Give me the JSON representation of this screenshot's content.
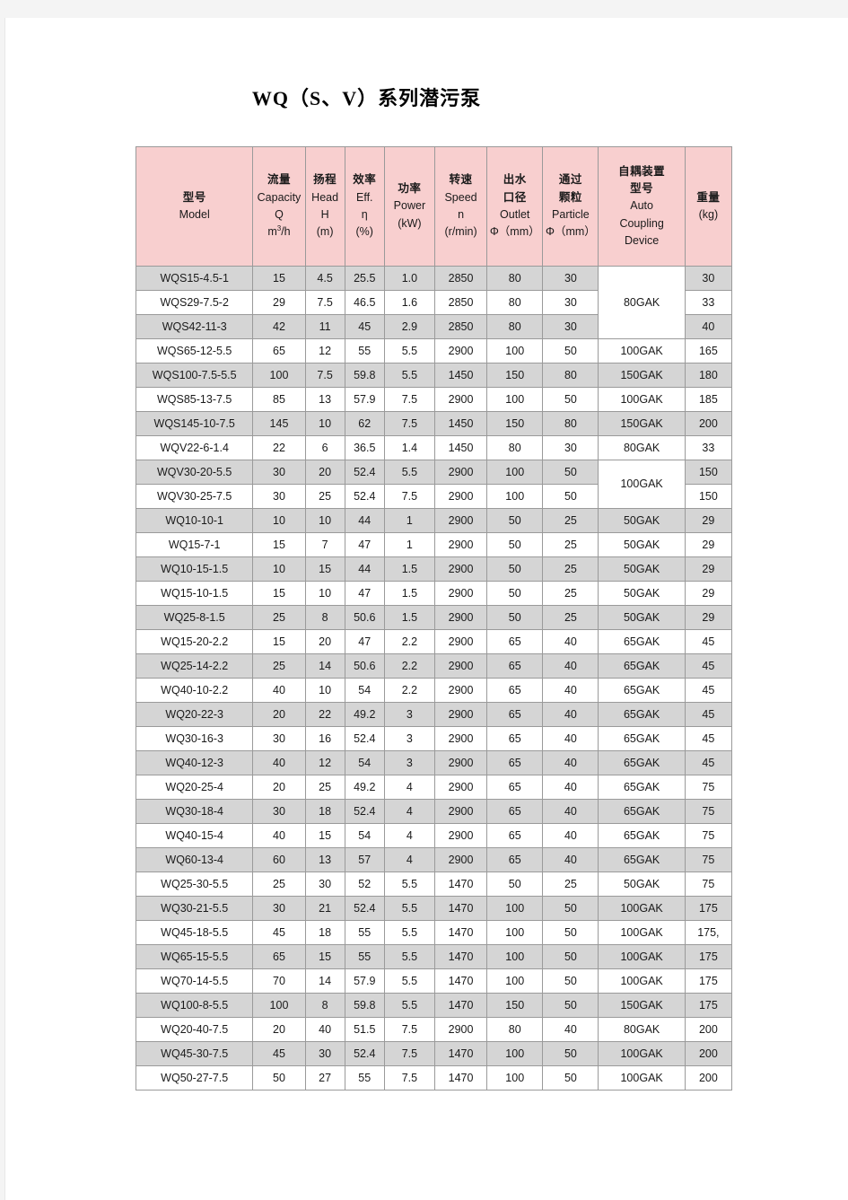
{
  "document": {
    "title": "WQ（S、V）系列潜污泵"
  },
  "table": {
    "columns": [
      {
        "key": "model",
        "cn": "型号",
        "en": "Model",
        "sym": "",
        "unit": ""
      },
      {
        "key": "cap",
        "cn": "流量",
        "en": "Capacity",
        "sym": "Q",
        "unit": "m3/h"
      },
      {
        "key": "head",
        "cn": "扬程",
        "en": "Head",
        "sym": "H",
        "unit": "(m)"
      },
      {
        "key": "eff",
        "cn": "效率",
        "en": "Eff.",
        "sym": "η",
        "unit": "(%)"
      },
      {
        "key": "power",
        "cn": "功率",
        "en": "Power",
        "sym": "",
        "unit": "(kW)"
      },
      {
        "key": "speed",
        "cn": "转速",
        "en": "Speed",
        "sym": "n",
        "unit": "(r/min)"
      },
      {
        "key": "outlet",
        "cn": "出水",
        "cn2": "口径",
        "en": "Outlet",
        "unit": "Φ（mm）"
      },
      {
        "key": "part",
        "cn": "通过",
        "cn2": "颗粒",
        "en": "Particle",
        "unit": "Φ（mm）"
      },
      {
        "key": "couple",
        "cn": "自耦装置",
        "cn2": "型号",
        "en": "Auto",
        "en2": "Coupling",
        "en3": "Device"
      },
      {
        "key": "weight",
        "cn": "重量",
        "en": "",
        "sym": "",
        "unit": "(kg)"
      }
    ],
    "rows": [
      {
        "model": "WQS15-4.5-1",
        "cap": "15",
        "head": "4.5",
        "eff": "25.5",
        "power": "1.0",
        "speed": "2850",
        "outlet": "80",
        "part": "30",
        "couple": "80GAK",
        "couple_span": 3,
        "weight": "30"
      },
      {
        "model": "WQS29-7.5-2",
        "cap": "29",
        "head": "7.5",
        "eff": "46.5",
        "power": "1.6",
        "speed": "2850",
        "outlet": "80",
        "part": "30",
        "couple": null,
        "couple_span": 0,
        "weight": "33"
      },
      {
        "model": "WQS42-11-3",
        "cap": "42",
        "head": "11",
        "eff": "45",
        "power": "2.9",
        "speed": "2850",
        "outlet": "80",
        "part": "30",
        "couple": null,
        "couple_span": 0,
        "weight": "40"
      },
      {
        "model": "WQS65-12-5.5",
        "cap": "65",
        "head": "12",
        "eff": "55",
        "power": "5.5",
        "speed": "2900",
        "outlet": "100",
        "part": "50",
        "couple": "100GAK",
        "couple_span": 1,
        "weight": "165"
      },
      {
        "model": "WQS100-7.5-5.5",
        "cap": "100",
        "head": "7.5",
        "eff": "59.8",
        "power": "5.5",
        "speed": "1450",
        "outlet": "150",
        "part": "80",
        "couple": "150GAK",
        "couple_span": 1,
        "weight": "180"
      },
      {
        "model": "WQS85-13-7.5",
        "cap": "85",
        "head": "13",
        "eff": "57.9",
        "power": "7.5",
        "speed": "2900",
        "outlet": "100",
        "part": "50",
        "couple": "100GAK",
        "couple_span": 1,
        "weight": "185"
      },
      {
        "model": "WQS145-10-7.5",
        "cap": "145",
        "head": "10",
        "eff": "62",
        "power": "7.5",
        "speed": "1450",
        "outlet": "150",
        "part": "80",
        "couple": "150GAK",
        "couple_span": 1,
        "weight": "200"
      },
      {
        "model": "WQV22-6-1.4",
        "cap": "22",
        "head": "6",
        "eff": "36.5",
        "power": "1.4",
        "speed": "1450",
        "outlet": "80",
        "part": "30",
        "couple": "80GAK",
        "couple_span": 1,
        "weight": "33"
      },
      {
        "model": "WQV30-20-5.5",
        "cap": "30",
        "head": "20",
        "eff": "52.4",
        "power": "5.5",
        "speed": "2900",
        "outlet": "100",
        "part": "50",
        "couple": "100GAK",
        "couple_span": 2,
        "weight": "150"
      },
      {
        "model": "WQV30-25-7.5",
        "cap": "30",
        "head": "25",
        "eff": "52.4",
        "power": "7.5",
        "speed": "2900",
        "outlet": "100",
        "part": "50",
        "couple": null,
        "couple_span": 0,
        "weight": "150"
      },
      {
        "model": "WQ10-10-1",
        "cap": "10",
        "head": "10",
        "eff": "44",
        "power": "1",
        "speed": "2900",
        "outlet": "50",
        "part": "25",
        "couple": "50GAK",
        "couple_span": 1,
        "weight": "29"
      },
      {
        "model": "WQ15-7-1",
        "cap": "15",
        "head": "7",
        "eff": "47",
        "power": "1",
        "speed": "2900",
        "outlet": "50",
        "part": "25",
        "couple": "50GAK",
        "couple_span": 1,
        "weight": "29"
      },
      {
        "model": "WQ10-15-1.5",
        "cap": "10",
        "head": "15",
        "eff": "44",
        "power": "1.5",
        "speed": "2900",
        "outlet": "50",
        "part": "25",
        "couple": "50GAK",
        "couple_span": 1,
        "weight": "29"
      },
      {
        "model": "WQ15-10-1.5",
        "cap": "15",
        "head": "10",
        "eff": "47",
        "power": "1.5",
        "speed": "2900",
        "outlet": "50",
        "part": "25",
        "couple": "50GAK",
        "couple_span": 1,
        "weight": "29"
      },
      {
        "model": "WQ25-8-1.5",
        "cap": "25",
        "head": "8",
        "eff": "50.6",
        "power": "1.5",
        "speed": "2900",
        "outlet": "50",
        "part": "25",
        "couple": "50GAK",
        "couple_span": 1,
        "weight": "29"
      },
      {
        "model": "WQ15-20-2.2",
        "cap": "15",
        "head": "20",
        "eff": "47",
        "power": "2.2",
        "speed": "2900",
        "outlet": "65",
        "part": "40",
        "couple": "65GAK",
        "couple_span": 1,
        "weight": "45"
      },
      {
        "model": "WQ25-14-2.2",
        "cap": "25",
        "head": "14",
        "eff": "50.6",
        "power": "2.2",
        "speed": "2900",
        "outlet": "65",
        "part": "40",
        "couple": "65GAK",
        "couple_span": 1,
        "weight": "45"
      },
      {
        "model": "WQ40-10-2.2",
        "cap": "40",
        "head": "10",
        "eff": "54",
        "power": "2.2",
        "speed": "2900",
        "outlet": "65",
        "part": "40",
        "couple": "65GAK",
        "couple_span": 1,
        "weight": "45"
      },
      {
        "model": "WQ20-22-3",
        "cap": "20",
        "head": "22",
        "eff": "49.2",
        "power": "3",
        "speed": "2900",
        "outlet": "65",
        "part": "40",
        "couple": "65GAK",
        "couple_span": 1,
        "weight": "45"
      },
      {
        "model": "WQ30-16-3",
        "cap": "30",
        "head": "16",
        "eff": "52.4",
        "power": "3",
        "speed": "2900",
        "outlet": "65",
        "part": "40",
        "couple": "65GAK",
        "couple_span": 1,
        "weight": "45"
      },
      {
        "model": "WQ40-12-3",
        "cap": "40",
        "head": "12",
        "eff": "54",
        "power": "3",
        "speed": "2900",
        "outlet": "65",
        "part": "40",
        "couple": "65GAK",
        "couple_span": 1,
        "weight": "45"
      },
      {
        "model": "WQ20-25-4",
        "cap": "20",
        "head": "25",
        "eff": "49.2",
        "power": "4",
        "speed": "2900",
        "outlet": "65",
        "part": "40",
        "couple": "65GAK",
        "couple_span": 1,
        "weight": "75"
      },
      {
        "model": "WQ30-18-4",
        "cap": "30",
        "head": "18",
        "eff": "52.4",
        "power": "4",
        "speed": "2900",
        "outlet": "65",
        "part": "40",
        "couple": "65GAK",
        "couple_span": 1,
        "weight": "75"
      },
      {
        "model": "WQ40-15-4",
        "cap": "40",
        "head": "15",
        "eff": "54",
        "power": "4",
        "speed": "2900",
        "outlet": "65",
        "part": "40",
        "couple": "65GAK",
        "couple_span": 1,
        "weight": "75"
      },
      {
        "model": "WQ60-13-4",
        "cap": "60",
        "head": "13",
        "eff": "57",
        "power": "4",
        "speed": "2900",
        "outlet": "65",
        "part": "40",
        "couple": "65GAK",
        "couple_span": 1,
        "weight": "75"
      },
      {
        "model": "WQ25-30-5.5",
        "cap": "25",
        "head": "30",
        "eff": "52",
        "power": "5.5",
        "speed": "1470",
        "outlet": "50",
        "part": "25",
        "couple": "50GAK",
        "couple_span": 1,
        "weight": "75"
      },
      {
        "model": "WQ30-21-5.5",
        "cap": "30",
        "head": "21",
        "eff": "52.4",
        "power": "5.5",
        "speed": "1470",
        "outlet": "100",
        "part": "50",
        "couple": "100GAK",
        "couple_span": 1,
        "weight": "175"
      },
      {
        "model": "WQ45-18-5.5",
        "cap": "45",
        "head": "18",
        "eff": "55",
        "power": "5.5",
        "speed": "1470",
        "outlet": "100",
        "part": "50",
        "couple": "100GAK",
        "couple_span": 1,
        "weight": "175,"
      },
      {
        "model": "WQ65-15-5.5",
        "cap": "65",
        "head": "15",
        "eff": "55",
        "power": "5.5",
        "speed": "1470",
        "outlet": "100",
        "part": "50",
        "couple": "100GAK",
        "couple_span": 1,
        "weight": "175"
      },
      {
        "model": "WQ70-14-5.5",
        "cap": "70",
        "head": "14",
        "eff": "57.9",
        "power": "5.5",
        "speed": "1470",
        "outlet": "100",
        "part": "50",
        "couple": "100GAK",
        "couple_span": 1,
        "weight": "175"
      },
      {
        "model": "WQ100-8-5.5",
        "cap": "100",
        "head": "8",
        "eff": "59.8",
        "power": "5.5",
        "speed": "1470",
        "outlet": "150",
        "part": "50",
        "couple": "150GAK",
        "couple_span": 1,
        "weight": "175"
      },
      {
        "model": "WQ20-40-7.5",
        "cap": "20",
        "head": "40",
        "eff": "51.5",
        "power": "7.5",
        "speed": "2900",
        "outlet": "80",
        "part": "40",
        "couple": "80GAK",
        "couple_span": 1,
        "weight": "200"
      },
      {
        "model": "WQ45-30-7.5",
        "cap": "45",
        "head": "30",
        "eff": "52.4",
        "power": "7.5",
        "speed": "1470",
        "outlet": "100",
        "part": "50",
        "couple": "100GAK",
        "couple_span": 1,
        "weight": "200"
      },
      {
        "model": "WQ50-27-7.5",
        "cap": "50",
        "head": "27",
        "eff": "55",
        "power": "7.5",
        "speed": "1470",
        "outlet": "100",
        "part": "50",
        "couple": "100GAK",
        "couple_span": 1,
        "weight": "200"
      }
    ]
  },
  "colors": {
    "header_fill": "#f8cfcf",
    "row_shade": "#d5d5d5",
    "row_plain": "#ffffff",
    "border": "#9a9a9a",
    "page_bg": "#ffffff",
    "canvas_bg": "#f4f4f4"
  }
}
